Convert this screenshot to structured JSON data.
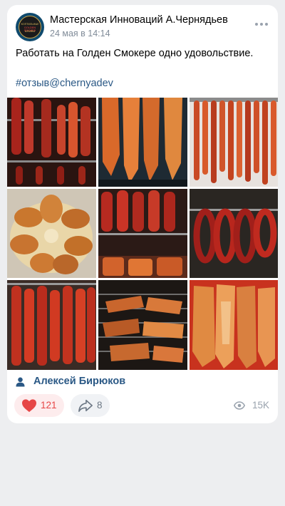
{
  "post": {
    "author": "Мастерская Инноваций А.Чернядьев",
    "date": "24 мая в 14:14",
    "text": "Работать на Голден Смокере одно удовольствие.",
    "hashtag": "#отзыв@chernyadev",
    "signer": "Алексей Бирюков",
    "avatar_lines": [
      "КОПТИЛЬНЫЕ",
      "GOLDEN SMOKER",
      "ШКАФЫ"
    ]
  },
  "gallery": {
    "photos": [
      {
        "subject": "sausages-on-rack"
      },
      {
        "subject": "smoked-fish-fillets"
      },
      {
        "subject": "hanging-sausage-sticks"
      },
      {
        "subject": "smoked-chicken-legs"
      },
      {
        "subject": "sausages-in-smoker"
      },
      {
        "subject": "sausage-rings"
      },
      {
        "subject": "hanging-salami"
      },
      {
        "subject": "smoked-meat-on-grill"
      },
      {
        "subject": "smoked-fish-halves"
      }
    ]
  },
  "stats": {
    "likes": "121",
    "shares": "8",
    "views": "15K"
  },
  "icons": {
    "like": "heart-icon",
    "share": "share-icon",
    "views": "eye-icon",
    "menu": "more-icon",
    "user": "user-icon"
  },
  "colors": {
    "link": "#2a5885",
    "like_red": "#e64646",
    "background": "#edeef0",
    "card": "#ffffff"
  }
}
